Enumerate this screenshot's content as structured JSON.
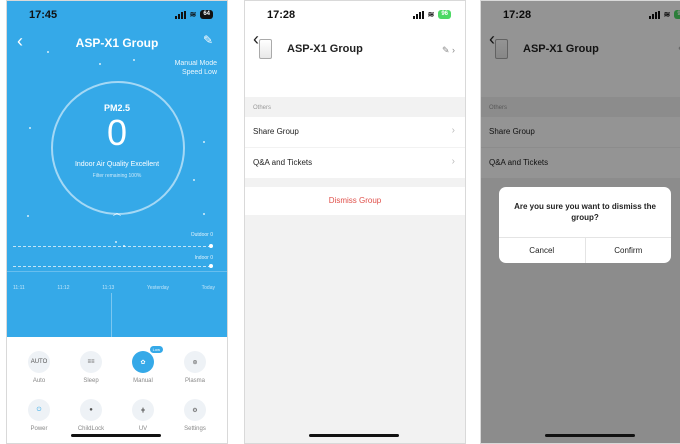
{
  "screen1": {
    "time": "17:45",
    "battery": "64",
    "title": "ASP-X1 Group",
    "mode_line1": "Manual Mode",
    "mode_line2": "Speed Low",
    "pm_label": "PM2.5",
    "pm_value": "0",
    "air_quality": "Indoor Air Quality Excellent",
    "filter": "Filter remaining 100%",
    "outdoor_label": "Outdoor 0",
    "indoor_label": "Indoor 0",
    "times": [
      "11:11",
      "11:12",
      "11:13",
      "Yesterday",
      "Today"
    ],
    "controls": [
      {
        "label": "Auto",
        "icon": "AUTO"
      },
      {
        "label": "Sleep",
        "icon": "≡≡"
      },
      {
        "label": "Manual",
        "icon": "✿",
        "badge": "Low"
      },
      {
        "label": "Plasma",
        "icon": "⊛"
      },
      {
        "label": "Power",
        "icon": "⏻"
      },
      {
        "label": "ChildLock",
        "icon": "●"
      },
      {
        "label": "UV",
        "icon": "⋕"
      },
      {
        "label": "Settings",
        "icon": "⚙"
      }
    ],
    "accent_color": "#35a9e8"
  },
  "screen2": {
    "time": "17:28",
    "battery": "96",
    "device_name": "ASP-X1 Group",
    "section": "Others",
    "rows": [
      "Share Group",
      "Q&A and Tickets"
    ],
    "dismiss": "Dismiss Group"
  },
  "screen3": {
    "time": "17:28",
    "battery": "96",
    "device_name": "ASP-X1 Group",
    "section": "Others",
    "rows": [
      "Share Group",
      "Q&A and Tickets"
    ],
    "dialog_message": "Are you sure you want to dismiss the group?",
    "cancel": "Cancel",
    "confirm": "Confirm"
  }
}
